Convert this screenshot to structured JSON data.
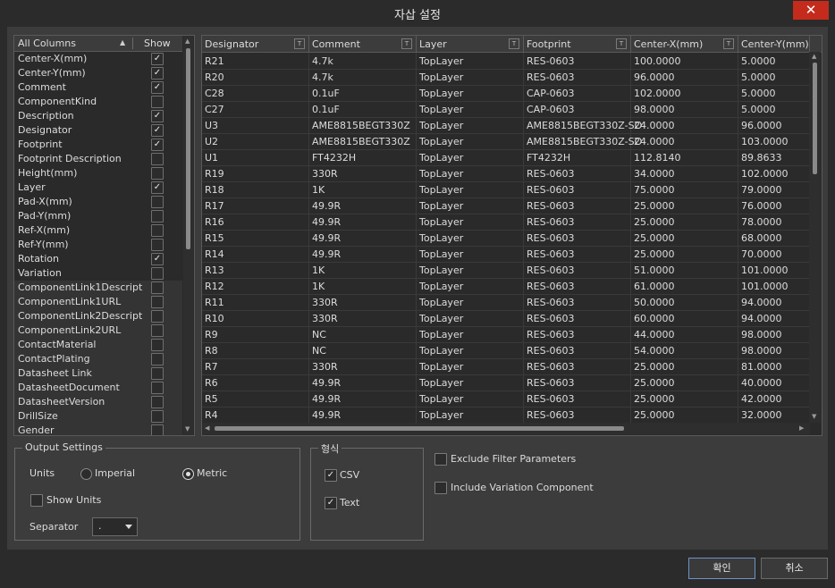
{
  "window": {
    "title": "자삽 설정",
    "close": "✕"
  },
  "columns_list": {
    "header_all": "All Columns",
    "header_show": "Show",
    "items": [
      {
        "label": "Center-X(mm)",
        "show": true
      },
      {
        "label": "Center-Y(mm)",
        "show": true
      },
      {
        "label": "Comment",
        "show": true
      },
      {
        "label": "ComponentKind",
        "show": false
      },
      {
        "label": "Description",
        "show": true
      },
      {
        "label": "Designator",
        "show": true
      },
      {
        "label": "Footprint",
        "show": true
      },
      {
        "label": "Footprint Description",
        "show": false
      },
      {
        "label": "Height(mm)",
        "show": false
      },
      {
        "label": "Layer",
        "show": true
      },
      {
        "label": "Pad-X(mm)",
        "show": false
      },
      {
        "label": "Pad-Y(mm)",
        "show": false
      },
      {
        "label": "Ref-X(mm)",
        "show": false
      },
      {
        "label": "Ref-Y(mm)",
        "show": false
      },
      {
        "label": "Rotation",
        "show": true
      },
      {
        "label": "Variation",
        "show": false
      },
      {
        "label": "ComponentLink1Descript",
        "show": false
      },
      {
        "label": "ComponentLink1URL",
        "show": false
      },
      {
        "label": "ComponentLink2Descript",
        "show": false
      },
      {
        "label": "ComponentLink2URL",
        "show": false
      },
      {
        "label": "ContactMaterial",
        "show": false
      },
      {
        "label": "ContactPlating",
        "show": false
      },
      {
        "label": "Datasheet Link",
        "show": false
      },
      {
        "label": "DatasheetDocument",
        "show": false
      },
      {
        "label": "DatasheetVersion",
        "show": false
      },
      {
        "label": "DrillSize",
        "show": false
      },
      {
        "label": "Gender",
        "show": false
      }
    ]
  },
  "grid": {
    "columns": [
      "Designator",
      "Comment",
      "Layer",
      "Footprint",
      "Center-X(mm)",
      "Center-Y(mm)"
    ],
    "rows": [
      [
        "R21",
        "4.7k",
        "TopLayer",
        "RES-0603",
        "100.0000",
        "5.0000"
      ],
      [
        "R20",
        "4.7k",
        "TopLayer",
        "RES-0603",
        "96.0000",
        "5.0000"
      ],
      [
        "C28",
        "0.1uF",
        "TopLayer",
        "CAP-0603",
        "102.0000",
        "5.0000"
      ],
      [
        "C27",
        "0.1uF",
        "TopLayer",
        "CAP-0603",
        "98.0000",
        "5.0000"
      ],
      [
        "U3",
        "AME8815BEGT330Z",
        "TopLayer",
        "AME8815BEGT330Z-SO",
        "24.0000",
        "96.0000"
      ],
      [
        "U2",
        "AME8815BEGT330Z",
        "TopLayer",
        "AME8815BEGT330Z-SO",
        "24.0000",
        "103.0000"
      ],
      [
        "U1",
        "FT4232H",
        "TopLayer",
        "FT4232H",
        "112.8140",
        "89.8633"
      ],
      [
        "R19",
        "330R",
        "TopLayer",
        "RES-0603",
        "34.0000",
        "102.0000"
      ],
      [
        "R18",
        "1K",
        "TopLayer",
        "RES-0603",
        "75.0000",
        "79.0000"
      ],
      [
        "R17",
        "49.9R",
        "TopLayer",
        "RES-0603",
        "25.0000",
        "76.0000"
      ],
      [
        "R16",
        "49.9R",
        "TopLayer",
        "RES-0603",
        "25.0000",
        "78.0000"
      ],
      [
        "R15",
        "49.9R",
        "TopLayer",
        "RES-0603",
        "25.0000",
        "68.0000"
      ],
      [
        "R14",
        "49.9R",
        "TopLayer",
        "RES-0603",
        "25.0000",
        "70.0000"
      ],
      [
        "R13",
        "1K",
        "TopLayer",
        "RES-0603",
        "51.0000",
        "101.0000"
      ],
      [
        "R12",
        "1K",
        "TopLayer",
        "RES-0603",
        "61.0000",
        "101.0000"
      ],
      [
        "R11",
        "330R",
        "TopLayer",
        "RES-0603",
        "50.0000",
        "94.0000"
      ],
      [
        "R10",
        "330R",
        "TopLayer",
        "RES-0603",
        "60.0000",
        "94.0000"
      ],
      [
        "R9",
        "NC",
        "TopLayer",
        "RES-0603",
        "44.0000",
        "98.0000"
      ],
      [
        "R8",
        "NC",
        "TopLayer",
        "RES-0603",
        "54.0000",
        "98.0000"
      ],
      [
        "R7",
        "330R",
        "TopLayer",
        "RES-0603",
        "25.0000",
        "81.0000"
      ],
      [
        "R6",
        "49.9R",
        "TopLayer",
        "RES-0603",
        "25.0000",
        "40.0000"
      ],
      [
        "R5",
        "49.9R",
        "TopLayer",
        "RES-0603",
        "25.0000",
        "42.0000"
      ],
      [
        "R4",
        "49.9R",
        "TopLayer",
        "RES-0603",
        "25.0000",
        "32.0000"
      ]
    ]
  },
  "output_settings": {
    "legend": "Output Settings",
    "units_label": "Units",
    "imperial": "Imperial",
    "metric": "Metric",
    "selected_unit": "Metric",
    "show_units": "Show Units",
    "show_units_checked": false,
    "separator_label": "Separator",
    "separator_value": "."
  },
  "format": {
    "legend": "형식",
    "csv": "CSV",
    "csv_checked": true,
    "text": "Text",
    "text_checked": true
  },
  "options": {
    "exclude_filter": "Exclude Filter Parameters",
    "exclude_filter_checked": false,
    "include_variation": "Include Variation Component",
    "include_variation_checked": false
  },
  "buttons": {
    "ok": "확인",
    "cancel": "취소"
  }
}
